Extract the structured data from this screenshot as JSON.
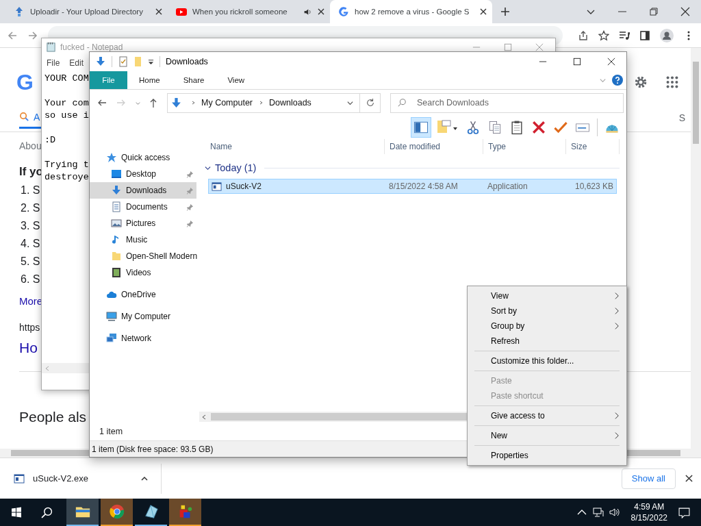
{
  "browser": {
    "tabs": [
      {
        "title": "Uploadir - Your Upload Directory",
        "kind": "upload",
        "audio": false,
        "selected": false
      },
      {
        "title": "When you rickroll someone",
        "kind": "video",
        "audio": true,
        "selected": false
      },
      {
        "title": "how 2 remove a virus - Google S",
        "kind": "search",
        "audio": false,
        "selected": true
      }
    ],
    "page": {
      "logo": "G",
      "tab_label": "A",
      "right_label": "S",
      "result_info": "Abou",
      "heading": "If yo",
      "steps": [
        "1. S",
        "2. S",
        "3. S",
        "4. S",
        "5. S",
        "6. S"
      ],
      "more": "More",
      "url": "https",
      "link": "Ho",
      "people_also": "People als"
    },
    "download": {
      "file": "uSuck-V2.exe",
      "show_all": "Show all"
    }
  },
  "notepad": {
    "title": "fucked - Notepad",
    "menu": [
      "File",
      "Edit"
    ],
    "paragraphs": [
      [
        "YOUR COM"
      ],
      [
        "Your com",
        "so use i"
      ],
      [
        ":D"
      ],
      [
        "Trying t",
        "destroye"
      ]
    ]
  },
  "explorer": {
    "title": "Downloads",
    "ribbon": [
      {
        "label": "File",
        "kind": "file"
      },
      {
        "label": "Home",
        "kind": "tab"
      },
      {
        "label": "Share",
        "kind": "tab"
      },
      {
        "label": "View",
        "kind": "tab"
      }
    ],
    "breadcrumb": [
      "My Computer",
      "Downloads"
    ],
    "search": {
      "placeholder": "Search Downloads"
    },
    "tools": [
      {
        "kind": "pane",
        "on": true
      },
      {
        "kind": "folder",
        "on": false
      },
      {
        "kind": "cut",
        "on": false
      },
      {
        "kind": "copy",
        "on": false
      },
      {
        "kind": "paste",
        "on": false
      },
      {
        "kind": "delete",
        "on": false
      },
      {
        "kind": "check",
        "on": false
      },
      {
        "kind": "rename",
        "on": false
      },
      {
        "kind": "shell",
        "on": false
      }
    ],
    "nav": [
      {
        "label": "Quick access",
        "kind": "star",
        "selected": false,
        "children": [
          {
            "label": "Desktop",
            "kind": "desktop",
            "pinned": true,
            "selected": false
          },
          {
            "label": "Downloads",
            "kind": "download",
            "pinned": true,
            "selected": true
          },
          {
            "label": "Documents",
            "kind": "document",
            "pinned": true,
            "selected": false
          },
          {
            "label": "Pictures",
            "kind": "pictures",
            "pinned": true,
            "selected": false
          },
          {
            "label": "Music",
            "kind": "music",
            "pinned": false,
            "selected": false
          },
          {
            "label": "Open-Shell Modern",
            "kind": "folder",
            "pinned": false,
            "selected": false
          },
          {
            "label": "Videos",
            "kind": "video",
            "pinned": false,
            "selected": false
          }
        ]
      },
      {
        "label": "OneDrive",
        "kind": "cloud",
        "selected": false
      },
      {
        "label": "My Computer",
        "kind": "computer",
        "selected": false
      },
      {
        "label": "Network",
        "kind": "network",
        "selected": false
      }
    ],
    "columns": [
      "Name",
      "Date modified",
      "Type",
      "Size"
    ],
    "group": {
      "label": "Today (1)",
      "expanded": true
    },
    "files": [
      {
        "name": "uSuck-V2",
        "date": "8/15/2022 4:58 AM",
        "type": "Application",
        "size": "10,623 KB",
        "selected": true
      }
    ],
    "count": "1 item",
    "status": "1 item (Disk free space: 93.5 GB)"
  },
  "context_menu": [
    {
      "kind": "item",
      "label": "View",
      "submenu": true,
      "disabled": false
    },
    {
      "kind": "item",
      "label": "Sort by",
      "submenu": true,
      "disabled": false
    },
    {
      "kind": "item",
      "label": "Group by",
      "submenu": true,
      "disabled": false
    },
    {
      "kind": "item",
      "label": "Refresh",
      "submenu": false,
      "disabled": false
    },
    {
      "kind": "separator"
    },
    {
      "kind": "item",
      "label": "Customize this folder...",
      "submenu": false,
      "disabled": false
    },
    {
      "kind": "separator"
    },
    {
      "kind": "item",
      "label": "Paste",
      "submenu": false,
      "disabled": true
    },
    {
      "kind": "item",
      "label": "Paste shortcut",
      "submenu": false,
      "disabled": true
    },
    {
      "kind": "separator"
    },
    {
      "kind": "item",
      "label": "Give access to",
      "submenu": true,
      "disabled": false
    },
    {
      "kind": "separator"
    },
    {
      "kind": "item",
      "label": "New",
      "submenu": true,
      "disabled": false
    },
    {
      "kind": "separator"
    },
    {
      "kind": "item",
      "label": "Properties",
      "submenu": false,
      "disabled": false
    }
  ],
  "taskbar": {
    "apps": [
      {
        "kind": "explorer",
        "active": true,
        "attention": false
      },
      {
        "kind": "browser",
        "active": false,
        "attention": true
      },
      {
        "kind": "prism",
        "active": false,
        "attention": false
      },
      {
        "kind": "cube",
        "active": false,
        "attention": true
      }
    ],
    "time": "4:59 AM",
    "date": "8/15/2022"
  }
}
